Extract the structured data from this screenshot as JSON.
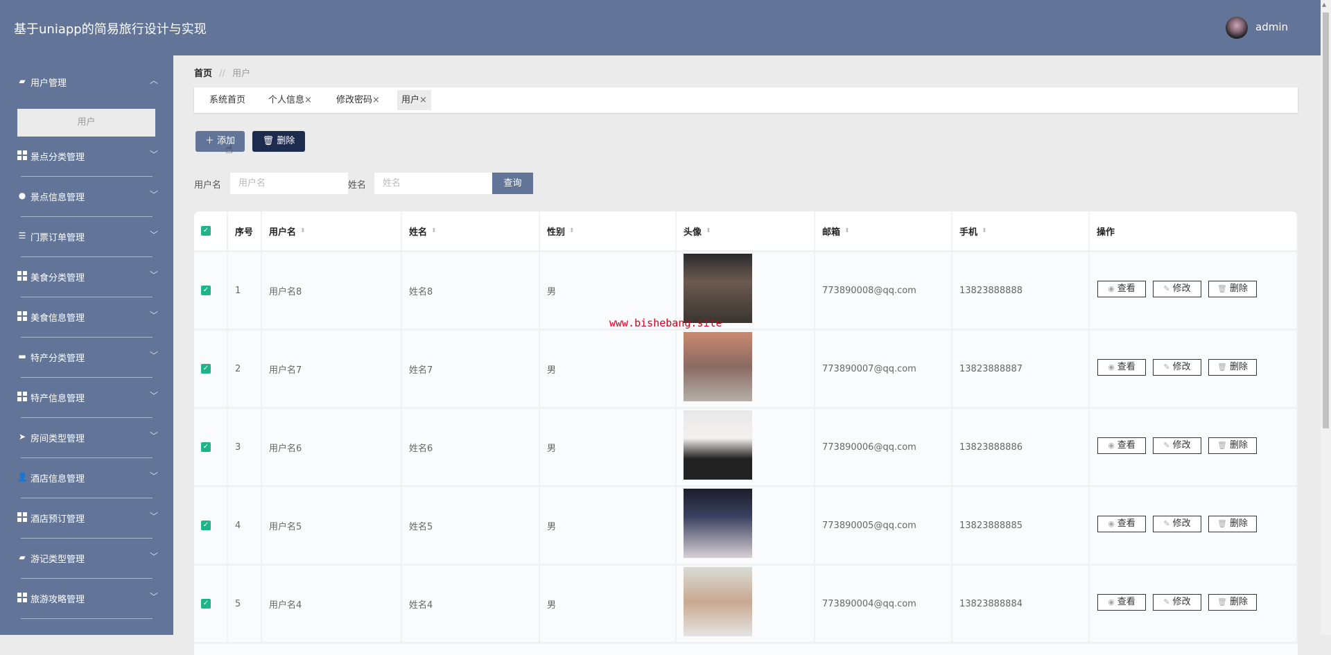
{
  "header": {
    "title": "基于uniapp的简易旅行设计与实现",
    "user": "admin"
  },
  "sidebar": {
    "items": [
      {
        "label": "用户管理",
        "icon": "briefcase-icon",
        "expanded": true
      },
      {
        "label": "景点分类管理",
        "icon": "grid-icon"
      },
      {
        "label": "景点信息管理",
        "icon": "bulb-icon"
      },
      {
        "label": "门票订单管理",
        "icon": "sliders-icon"
      },
      {
        "label": "美食分类管理",
        "icon": "grid-icon"
      },
      {
        "label": "美食信息管理",
        "icon": "grid-icon"
      },
      {
        "label": "特产分类管理",
        "icon": "monitor-icon"
      },
      {
        "label": "特产信息管理",
        "icon": "grid-icon"
      },
      {
        "label": "房间类型管理",
        "icon": "paper-plane-icon"
      },
      {
        "label": "酒店信息管理",
        "icon": "user-icon"
      },
      {
        "label": "酒店预订管理",
        "icon": "grid-icon"
      },
      {
        "label": "游记类型管理",
        "icon": "wallet-icon"
      },
      {
        "label": "旅游攻略管理",
        "icon": "grid-icon"
      }
    ],
    "submenu": "用户"
  },
  "breadcrumb": {
    "home": "首页",
    "sep": "//",
    "current": "用户"
  },
  "tabs": [
    {
      "label": "系统首页"
    },
    {
      "label": "个人信息",
      "close": "×"
    },
    {
      "label": "修改密码",
      "close": "×"
    },
    {
      "label": "用户",
      "close": "×",
      "active": true
    }
  ],
  "toolbar": {
    "add": "添加",
    "delete": "删除"
  },
  "search": {
    "username_label": "用户名",
    "username_placeholder": "用户名",
    "name_label": "姓名",
    "name_placeholder": "姓名",
    "query": "查询"
  },
  "table": {
    "columns": [
      "序号",
      "用户名",
      "姓名",
      "性别",
      "头像",
      "邮箱",
      "手机",
      "操作"
    ],
    "rows": [
      {
        "index": "1",
        "username": "用户名8",
        "name": "姓名8",
        "gender": "男",
        "email": "773890008@qq.com",
        "phone": "13823888888",
        "checked": true
      },
      {
        "index": "2",
        "username": "用户名7",
        "name": "姓名7",
        "gender": "男",
        "email": "773890007@qq.com",
        "phone": "13823888887",
        "checked": true
      },
      {
        "index": "3",
        "username": "用户名6",
        "name": "姓名6",
        "gender": "男",
        "email": "773890006@qq.com",
        "phone": "13823888886",
        "checked": true
      },
      {
        "index": "4",
        "username": "用户名5",
        "name": "姓名5",
        "gender": "男",
        "email": "773890005@qq.com",
        "phone": "13823888885",
        "checked": true
      },
      {
        "index": "5",
        "username": "用户名4",
        "name": "姓名4",
        "gender": "男",
        "email": "773890004@qq.com",
        "phone": "13823888884",
        "checked": true
      }
    ],
    "actions": {
      "view": "查看",
      "edit": "修改",
      "delete": "删除"
    }
  },
  "watermark": "www.bishebang.site",
  "colors": {
    "primary": "#627598",
    "dark": "#1d2b4f",
    "check": "#1fb38a",
    "watermark": "#d0021b"
  }
}
